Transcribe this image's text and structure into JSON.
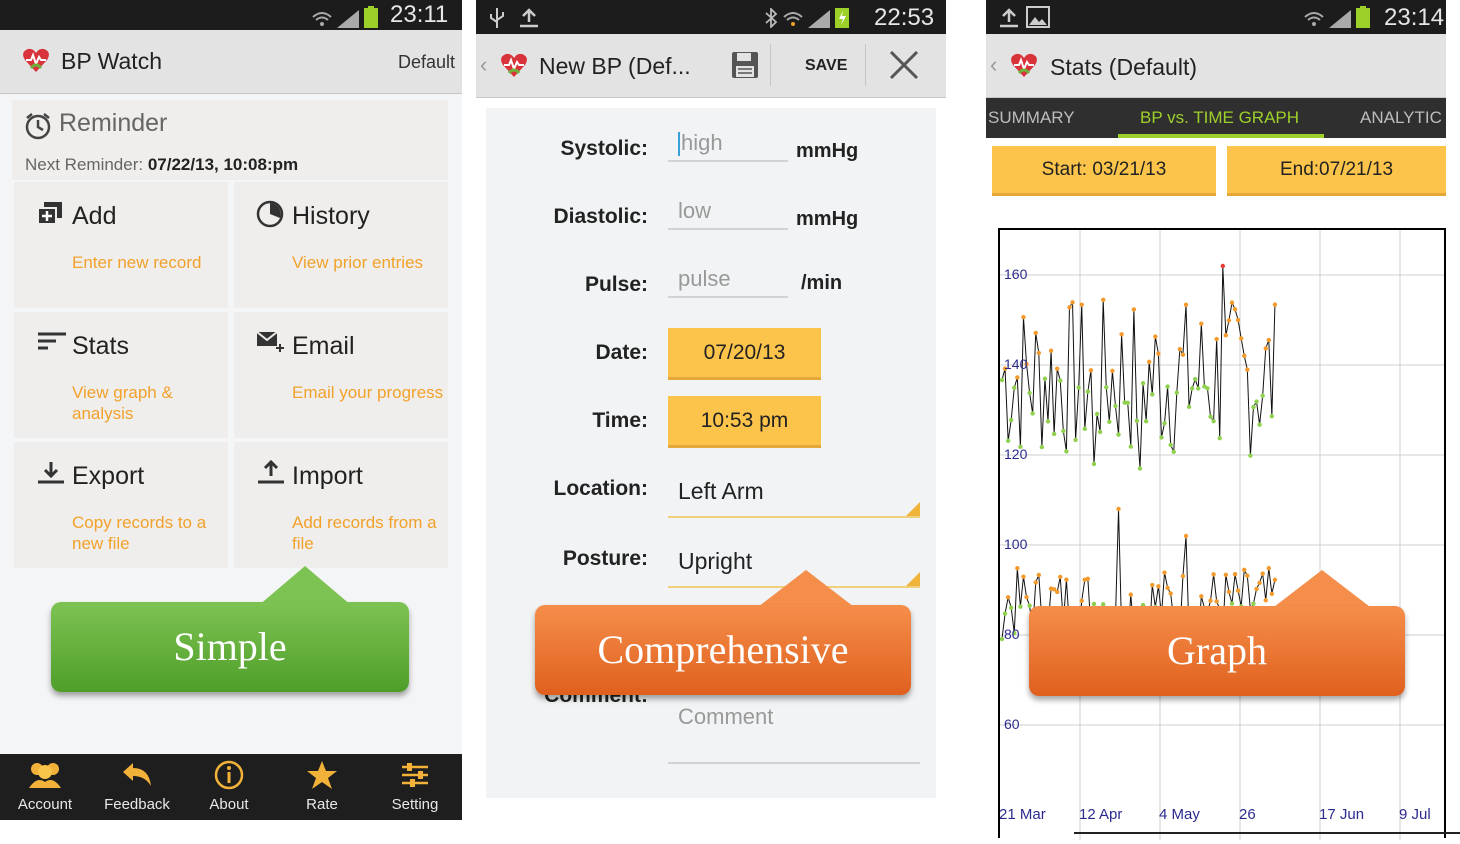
{
  "phone1": {
    "status": {
      "time": "23:11"
    },
    "app_title": "BP Watch",
    "profile": "Default",
    "reminder": {
      "title": "Reminder",
      "next_label": "Next Reminder:",
      "next_value": "07/22/13, 10:08:pm"
    },
    "tiles": [
      {
        "title": "Add",
        "subtitle": "Enter new record",
        "icon": "add-record-icon"
      },
      {
        "title": "History",
        "subtitle": "View prior entries",
        "icon": "history-icon"
      },
      {
        "title": "Stats",
        "subtitle": "View graph & analysis",
        "icon": "stats-icon"
      },
      {
        "title": "Email",
        "subtitle": "Email your progress",
        "icon": "email-icon"
      },
      {
        "title": "Export",
        "subtitle": "Copy records to a new file",
        "icon": "export-icon"
      },
      {
        "title": "Import",
        "subtitle": "Add records from a file",
        "icon": "import-icon"
      }
    ],
    "callout": "Simple",
    "bottom_nav": [
      {
        "label": "Account",
        "icon": "account-icon"
      },
      {
        "label": "Feedback",
        "icon": "feedback-icon"
      },
      {
        "label": "About",
        "icon": "about-icon"
      },
      {
        "label": "Rate",
        "icon": "star-icon"
      },
      {
        "label": "Setting",
        "icon": "settings-icon"
      }
    ]
  },
  "phone2": {
    "status": {
      "time": "22:53"
    },
    "title": "New BP (Def...",
    "save_label": "SAVE",
    "fields": {
      "systolic": {
        "label": "Systolic:",
        "placeholder": "high",
        "unit": "mmHg"
      },
      "diastolic": {
        "label": "Diastolic:",
        "placeholder": "low",
        "unit": "mmHg"
      },
      "pulse": {
        "label": "Pulse:",
        "placeholder": "pulse",
        "unit": "/min"
      },
      "date": {
        "label": "Date:",
        "value": "07/20/13"
      },
      "time": {
        "label": "Time:",
        "value": "10:53 pm"
      },
      "location": {
        "label": "Location:",
        "value": "Left Arm"
      },
      "posture": {
        "label": "Posture:",
        "value": "Upright"
      },
      "comment": {
        "label": "Comment:",
        "placeholder": "Comment"
      }
    },
    "callout": "Comprehensive"
  },
  "phone3": {
    "status": {
      "time": "23:14"
    },
    "title": "Stats (Default)",
    "tabs": [
      "SUMMARY",
      "BP vs. TIME GRAPH",
      "ANALYTIC"
    ],
    "active_tab": "BP vs. TIME GRAPH",
    "start_label": "Start: 03/21/13",
    "end_label": "End:07/21/13",
    "callout": "Graph",
    "chart_data": {
      "type": "line",
      "y_ticks": [
        "160",
        "140",
        "120",
        "100",
        "80",
        "60"
      ],
      "x_ticks": [
        "21 Mar",
        "12 Apr",
        "4 May",
        "26",
        "17 Jun",
        "9 Jul"
      ],
      "ylim": [
        52,
        168
      ],
      "series": [
        {
          "values_note": "systolic readings between ~118 and ~162"
        },
        {
          "values_note": "diastolic readings between ~78 and ~108"
        }
      ],
      "colors": {
        "line": "#111111",
        "high_point": "#f39a2c",
        "low_point": "#8fd14f",
        "max_point": "#e53935"
      }
    }
  }
}
